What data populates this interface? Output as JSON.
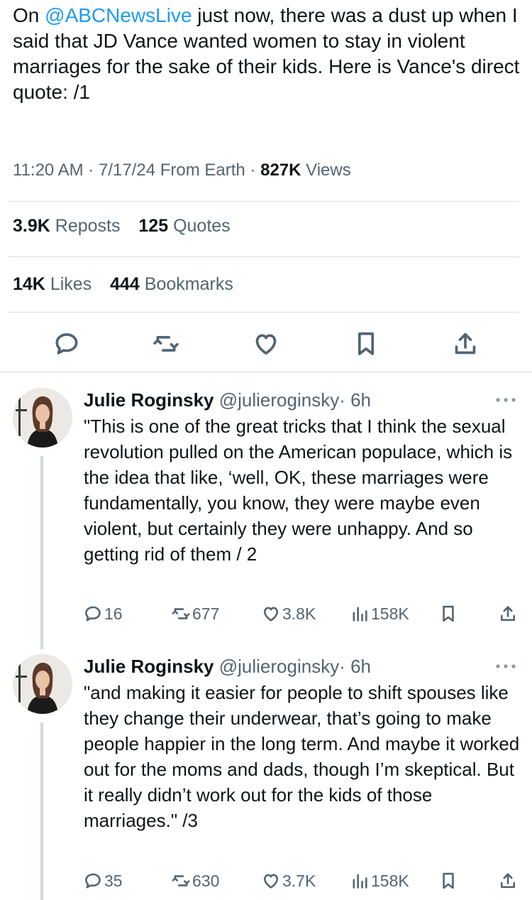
{
  "main_tweet": {
    "text_pre": "On ",
    "mention": "@ABCNewsLive",
    "text_post": " just now, there was a dust up when I said that JD Vance wanted women to stay in violent marriages for the sake of their kids. Here is Vance's direct quote: /1",
    "time": "11:20 AM",
    "date": "7/17/24",
    "source": "From Earth",
    "views_count": "827K",
    "views_label": "Views",
    "reposts_count": "3.9K",
    "reposts_label": "Reposts",
    "quotes_count": "125",
    "quotes_label": "Quotes",
    "likes_count": "14K",
    "likes_label": "Likes",
    "bookmarks_count": "444",
    "bookmarks_label": "Bookmarks",
    "sep": "·"
  },
  "replies": [
    {
      "name": "Julie Roginsky",
      "handle": "@julieroginsky",
      "time": "· 6h",
      "text": "\"This is one of the great tricks that I think the sexual revolution pulled on the American populace, which is the idea that like, ‘well, OK, these marriages were fundamentally, you know, they were maybe even violent, but certainly they were unhappy. And so getting rid of them / 2",
      "replies": "16",
      "reposts": "677",
      "likes": "3.8K",
      "views": "158K"
    },
    {
      "name": "Julie Roginsky",
      "handle": "@julieroginsky",
      "time": "· 6h",
      "text": "\"and making it easier for people to shift spouses like they change their underwear, that’s going to make people happier in the long term. And maybe it worked out for the moms and dads, though I’m skeptical. But it really didn’t work out for the kids of those marriages.\" /3",
      "replies": "35",
      "reposts": "630",
      "likes": "3.7K",
      "views": "158K"
    }
  ],
  "icons": {
    "reply": "reply-icon",
    "repost": "repost-icon",
    "like": "heart-icon",
    "bookmark": "bookmark-icon",
    "share": "share-icon",
    "views": "views-icon",
    "more": "more-icon"
  },
  "colors": {
    "accent": "#1d9bf0",
    "text": "#0f1419",
    "secondary": "#536471",
    "divider": "#d9dee2"
  }
}
